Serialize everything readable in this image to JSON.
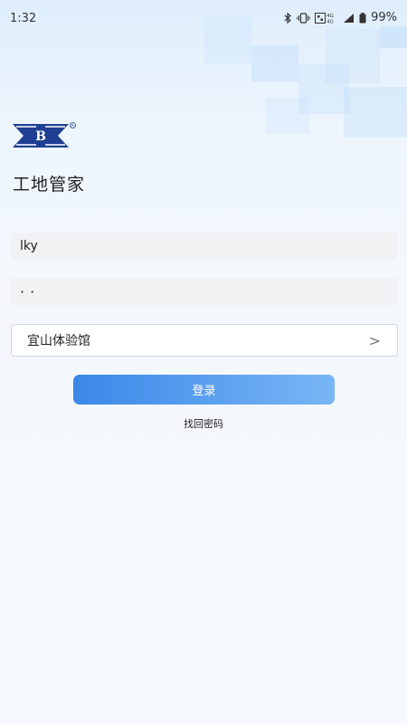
{
  "status_bar": {
    "time": "1:32",
    "battery": "99%",
    "icons": [
      "bluetooth-icon",
      "vibrate-icon",
      "network-icon",
      "signal-icon",
      "battery-icon"
    ]
  },
  "app": {
    "brand_logo_letter": "B",
    "title": "工地管家"
  },
  "form": {
    "username_value": "lky",
    "password_value": "··",
    "site_selector": "宜山体验馆",
    "site_chevron": ">",
    "login_label": "登录",
    "forgot_label": "找回密码"
  },
  "colors": {
    "accent_start": "#3b88e8",
    "accent_end": "#79b6f5",
    "logo_blue": "#1f3f93"
  }
}
